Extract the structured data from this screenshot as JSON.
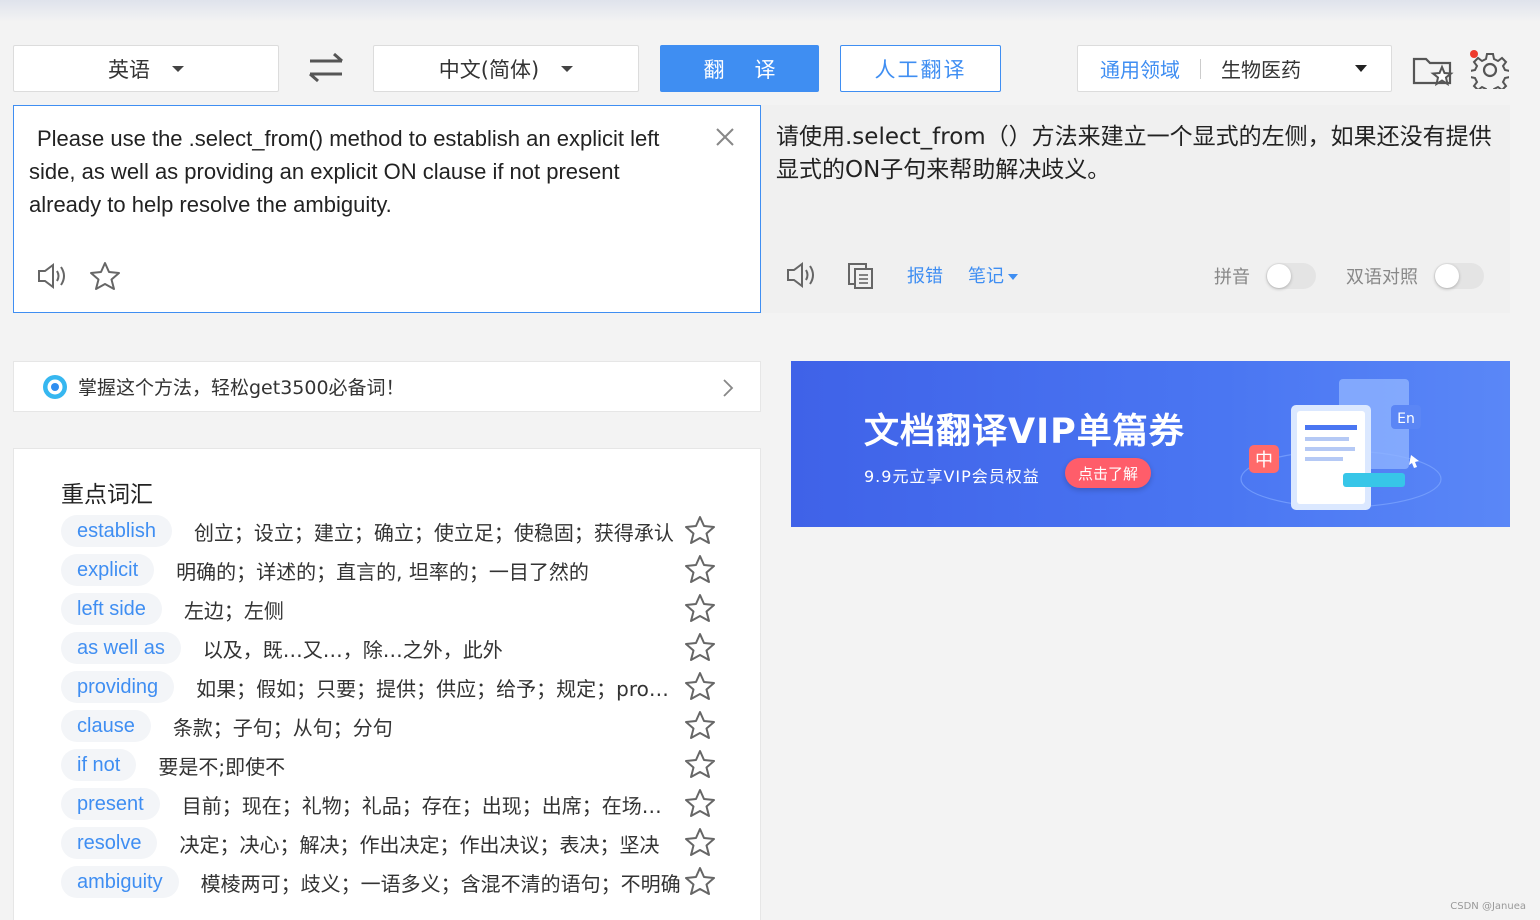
{
  "toolbar": {
    "source_lang": "英语",
    "target_lang": "中文(简体)",
    "translate_label": "翻译",
    "human_translate_label": "人工翻译",
    "domain_general": "通用领域",
    "domain_specific": "生物医药",
    "icons": [
      "swap-icon",
      "favorites-folder-icon",
      "gear-icon"
    ],
    "colors": {
      "accent": "#3f8ef2",
      "notification": "#ee3b2d"
    }
  },
  "source": {
    "text": "Please use the .select_from() method to establish an explicit left side, as well as providing an explicit ON clause if not present already to help resolve the ambiguity."
  },
  "target": {
    "text": "请使用.select_from（）方法来建立一个显式的左侧，如果还没有提供显式的ON子句来帮助解决歧义。",
    "report_error_label": "报错",
    "notes_label": "笔记",
    "pinyin_label": "拼音",
    "bilingual_label": "双语对照",
    "pinyin_on": false,
    "bilingual_on": false
  },
  "promo": {
    "text": "掌握这个方法，轻松get3500必备词！"
  },
  "vocab": {
    "title": "重点词汇",
    "items": [
      {
        "word": "establish",
        "def": "创立；设立；建立；确立；使立足；使稳固；获得承认"
      },
      {
        "word": "explicit",
        "def": "明确的；详述的；直言的, 坦率的；一目了然的"
      },
      {
        "word": "left side",
        "def": "左边；左侧"
      },
      {
        "word": "as well as",
        "def": "以及，既…又…，除…之外，此外"
      },
      {
        "word": "providing",
        "def": "如果；假如；只要；提供；供应；给予；规定；provide的现在分词"
      },
      {
        "word": "clause",
        "def": "条款；子句；从句；分句"
      },
      {
        "word": "if not",
        "def": "要是不;即使不"
      },
      {
        "word": "present",
        "def": "目前；现在；礼物；礼品；存在；出现；出席；在场；现在的"
      },
      {
        "word": "resolve",
        "def": "决定；决心；解决；作出决定；作出决议；表决；坚决"
      },
      {
        "word": "ambiguity",
        "def": "模棱两可；歧义；一语多义；含混不清的语句；不明确"
      }
    ]
  },
  "banner": {
    "title": "文档翻译VIP单篇券",
    "subtitle": "9.9元立享VIP会员权益",
    "cta": "点击了解",
    "badge_zh": "中",
    "badge_en": "En"
  },
  "watermark": "CSDN @Januea"
}
